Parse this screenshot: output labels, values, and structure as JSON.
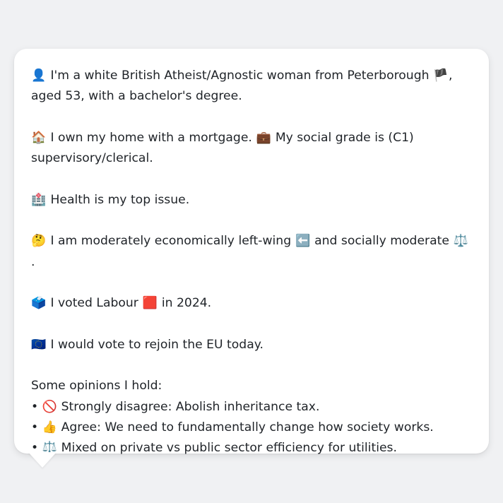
{
  "profile": {
    "line1": {
      "icon": "👤",
      "text_a": "I'm a white British Atheist/Agnostic woman from Peterborough",
      "flag": "🏴",
      "text_b": ", aged 53, with a bachelor's degree."
    },
    "line2": {
      "icon_house": "🏠",
      "text_a": "I own my home with a mortgage.",
      "icon_briefcase": "💼",
      "text_b": "My social grade is (C1) supervisory/clerical."
    },
    "line3": {
      "icon": "🏥",
      "text": "Health is my top issue."
    },
    "line4": {
      "icon": "🤔",
      "text_a": "I am moderately economically left-wing",
      "icon_arrow": "⬅️",
      "text_b": "and socially moderate",
      "icon_scales": "⚖️",
      "text_c": "."
    },
    "line5": {
      "icon": "🗳️",
      "text_a": "I voted Labour",
      "icon_square": "🟥",
      "text_b": "in 2024."
    },
    "line6": {
      "icon": "🇪🇺",
      "text": "I would vote to rejoin the EU today."
    },
    "opinions": {
      "heading": "Some opinions I hold:",
      "items": [
        {
          "bullet": "•",
          "icon": "🚫",
          "text": "Strongly disagree: Abolish inheritance tax."
        },
        {
          "bullet": "•",
          "icon": "👍",
          "text": "Agree: We need to fundamentally change how society works."
        },
        {
          "bullet": "•",
          "icon": "⚖️",
          "text": "Mixed on private vs public sector efficiency for utilities."
        }
      ]
    }
  },
  "colors": {
    "background": "#f0f1f3",
    "bubble": "#ffffff",
    "text": "#1f2328"
  }
}
